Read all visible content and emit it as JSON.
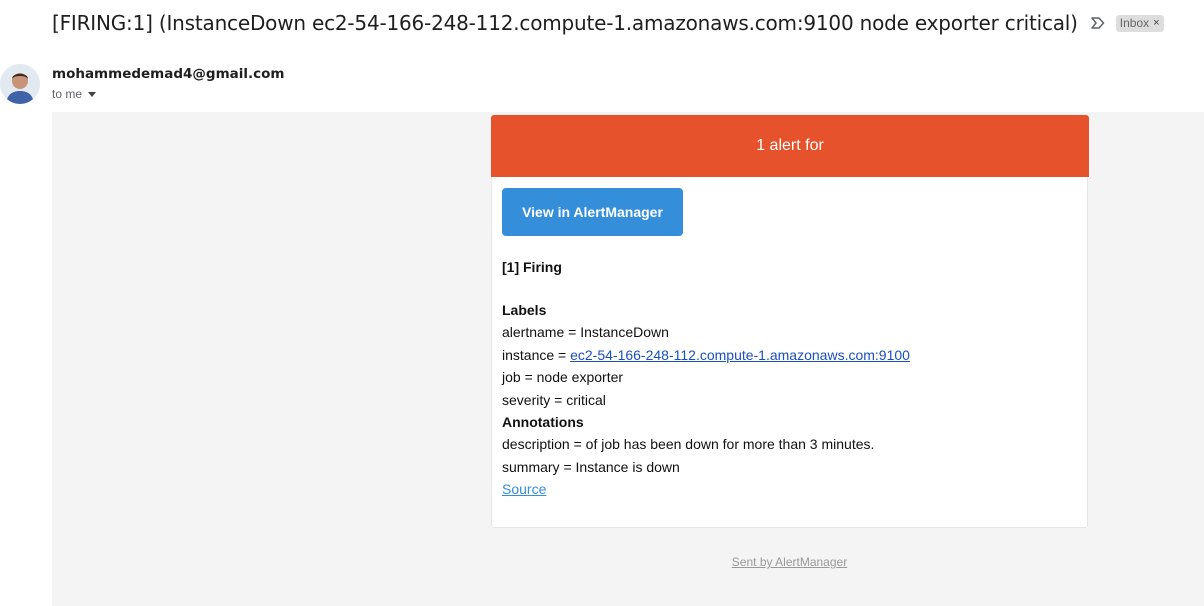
{
  "email": {
    "subject": "[FIRING:1] (InstanceDown ec2-54-166-248-112.compute-1.amazonaws.com:9100 node exporter critical)",
    "label_chip": "Inbox",
    "label_chip_close": "×",
    "sender": "mohammedemad4@gmail.com",
    "recipient": "to me"
  },
  "alert": {
    "header": "1 alert for",
    "button_label": "View in AlertManager",
    "firing_heading": "[1] Firing",
    "labels_heading": "Labels",
    "labels": {
      "alertname": "alertname = InstanceDown",
      "instance_prefix": "instance = ",
      "instance_link": "ec2-54-166-248-112.compute-1.amazonaws.com:9100",
      "job": "job = node exporter",
      "severity": "severity = critical"
    },
    "annotations_heading": "Annotations",
    "annotations": {
      "description": "description = of job has been down for more than 3 minutes.",
      "summary": "summary = Instance is down"
    },
    "source_link": "Source",
    "footer": "Sent by AlertManager"
  },
  "colors": {
    "header_red": "#e6522c",
    "button_blue": "#348eda",
    "background": "#f4f4f4"
  }
}
